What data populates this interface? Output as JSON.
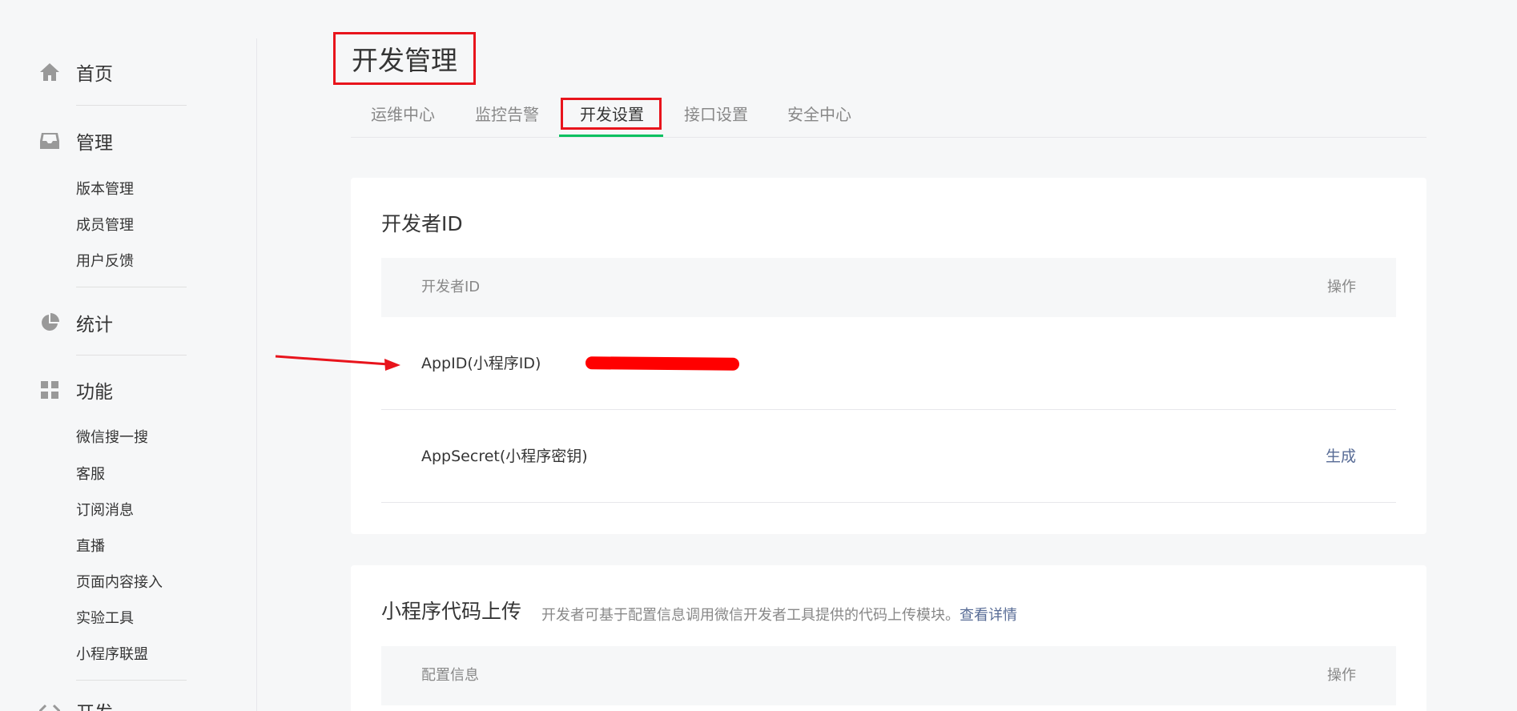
{
  "sidebar": {
    "groups": [
      {
        "label": "首页",
        "icon": "home-icon",
        "items": []
      },
      {
        "label": "管理",
        "icon": "inbox-icon",
        "items": [
          "版本管理",
          "成员管理",
          "用户反馈"
        ]
      },
      {
        "label": "统计",
        "icon": "pie-chart-icon",
        "items": []
      },
      {
        "label": "功能",
        "icon": "grid-icon",
        "items": [
          "微信搜一搜",
          "客服",
          "订阅消息",
          "直播",
          "页面内容接入",
          "实验工具",
          "小程序联盟"
        ]
      },
      {
        "label": "开发",
        "icon": "code-icon",
        "items": []
      }
    ]
  },
  "page": {
    "title": "开发管理"
  },
  "tabs": [
    "运维中心",
    "监控告警",
    "开发设置",
    "接口设置",
    "安全中心"
  ],
  "active_tab": "开发设置",
  "developer_id_card": {
    "title": "开发者ID",
    "columns": {
      "col1": "开发者ID",
      "col2": "操作"
    },
    "rows": [
      {
        "name": "AppID(小程序ID)",
        "action": ""
      },
      {
        "name": "AppSecret(小程序密钥)",
        "action": "生成"
      }
    ]
  },
  "upload_card": {
    "title": "小程序代码上传",
    "description": "开发者可基于配置信息调用微信开发者工具提供的代码上传模块。",
    "link": "查看详情",
    "columns": {
      "col1": "配置信息",
      "col2": "操作"
    }
  },
  "colors": {
    "accent_green": "#07c160",
    "highlight_red": "#e8141c",
    "link_blue": "#576b95"
  }
}
